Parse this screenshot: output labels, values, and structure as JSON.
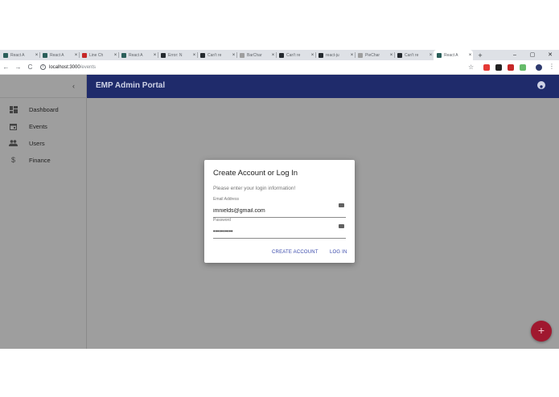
{
  "browser": {
    "tabs": [
      {
        "label": "React A",
        "favicon_color": "#2b5f5a"
      },
      {
        "label": "React A",
        "favicon_color": "#2b5f5a"
      },
      {
        "label": "Line Ch",
        "favicon_color": "#c62828"
      },
      {
        "label": "React A",
        "favicon_color": "#2b5f5a"
      },
      {
        "label": "Error: N",
        "favicon_color": "#24292e"
      },
      {
        "label": "Can't re",
        "favicon_color": "#24292e"
      },
      {
        "label": "BarChar",
        "favicon_color": "#9e9e9e"
      },
      {
        "label": "Can't re",
        "favicon_color": "#24292e"
      },
      {
        "label": "react-ju",
        "favicon_color": "#24292e"
      },
      {
        "label": "PieChar",
        "favicon_color": "#9e9e9e"
      },
      {
        "label": "Can't re",
        "favicon_color": "#24292e"
      },
      {
        "label": "React A",
        "favicon_color": "#2b5f5a"
      }
    ],
    "active_tab_index": 11,
    "tab_close_glyph": "×",
    "new_tab_glyph": "+",
    "window_controls": {
      "minimize": "–",
      "restore": "▢",
      "close": "✕"
    },
    "nav": {
      "back": "←",
      "forward": "→",
      "reload": "C"
    },
    "info_glyph": "i",
    "url_host": "localhost:3000",
    "url_path": "/events",
    "star_glyph": "☆",
    "extension_colors": [
      "#e53935",
      "#212121",
      "#c62828",
      "#66bb6a"
    ],
    "menu_glyph": "⋮"
  },
  "app": {
    "title": "EMP Admin Portal",
    "collapse_glyph": "‹",
    "nav_items": [
      {
        "label": "Dashboard",
        "icon": "dashboard-icon"
      },
      {
        "label": "Events",
        "icon": "calendar-icon"
      },
      {
        "label": "Users",
        "icon": "people-icon"
      },
      {
        "label": "Finance",
        "icon": "dollar-icon"
      }
    ],
    "fab_glyph": "+",
    "colors": {
      "appbar": "#1f2b6b",
      "overlay": "#9e9e9e",
      "accent": "#3949ab",
      "fab": "#a0182f"
    }
  },
  "dialog": {
    "title": "Create Account or Log In",
    "subtitle": "Please enter your login information!",
    "email_label": "Email Address",
    "email_value": "imnields@gmail.com",
    "password_label": "Password",
    "password_value": "••••••••••",
    "create_account_label": "CREATE ACCOUNT",
    "login_label": "LOG IN"
  }
}
